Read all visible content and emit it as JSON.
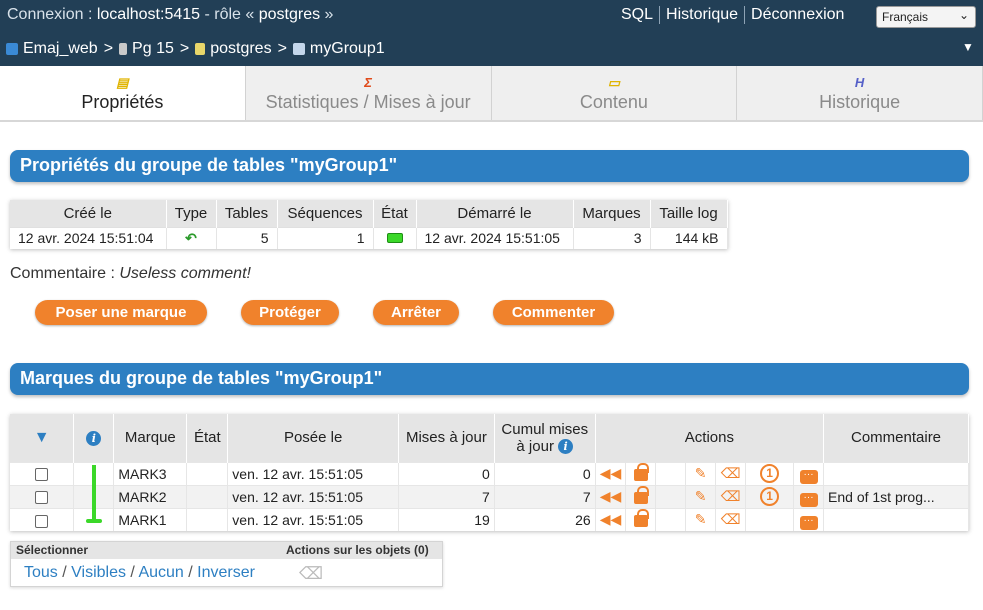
{
  "header": {
    "connection_prefix": "Connexion : ",
    "host": "localhost:5415",
    "role_prefix": " - rôle « ",
    "role": "postgres",
    "role_suffix": " »",
    "links": [
      "SQL",
      "Historique",
      "Déconnexion"
    ],
    "language": "Français",
    "breadcrumb": [
      "Emaj_web",
      "Pg 15",
      "postgres",
      "myGroup1"
    ]
  },
  "tabs": [
    {
      "label": "Propriétés",
      "icon": "properties-icon",
      "active": true
    },
    {
      "label": "Statistiques / Mises à jour",
      "icon": "sigma-icon",
      "active": false
    },
    {
      "label": "Contenu",
      "icon": "folder-icon",
      "active": false
    },
    {
      "label": "Historique",
      "icon": "history-icon",
      "active": false
    }
  ],
  "properties": {
    "title": "Propriétés du groupe de tables \"myGroup1\"",
    "columns": [
      "Créé le",
      "Type",
      "Tables",
      "Séquences",
      "État",
      "Démarré le",
      "Marques",
      "Taille log"
    ],
    "row": {
      "created": "12 avr. 2024 15:51:04",
      "tables": "5",
      "sequences": "1",
      "started": "12 avr. 2024 15:51:05",
      "marks": "3",
      "log_size": "144 kB"
    },
    "comment_label": "Commentaire : ",
    "comment_value": "Useless comment!"
  },
  "buttons": [
    "Poser une marque",
    "Protéger",
    "Arrêter",
    "Commenter"
  ],
  "marks": {
    "title": "Marques du groupe de tables \"myGroup1\"",
    "columns": {
      "mark": "Marque",
      "state": "État",
      "set_at": "Posée le",
      "changes": "Mises à jour",
      "cumulative": "Cumul mises à jour",
      "actions": "Actions",
      "comment": "Commentaire"
    },
    "rows": [
      {
        "name": "MARK3",
        "state": "",
        "set_at": "ven. 12 avr. 15:51:05",
        "changes": "0",
        "cumulative": "0",
        "comment": ""
      },
      {
        "name": "MARK2",
        "state": "",
        "set_at": "ven. 12 avr. 15:51:05",
        "changes": "7",
        "cumulative": "7",
        "comment": "End of 1st prog..."
      },
      {
        "name": "MARK1",
        "state": "",
        "set_at": "ven. 12 avr. 15:51:05",
        "changes": "19",
        "cumulative": "26",
        "comment": ""
      }
    ]
  },
  "selection": {
    "label": "Sélectionner",
    "actions_label": "Actions sur les objets (0)",
    "links": [
      "Tous",
      "Visibles",
      "Aucun",
      "Inverser"
    ]
  },
  "colors": {
    "header_bg": "#223f56",
    "section_title": "#2d7fc2",
    "accent": "#f0822c",
    "timeline": "#3bd829"
  }
}
